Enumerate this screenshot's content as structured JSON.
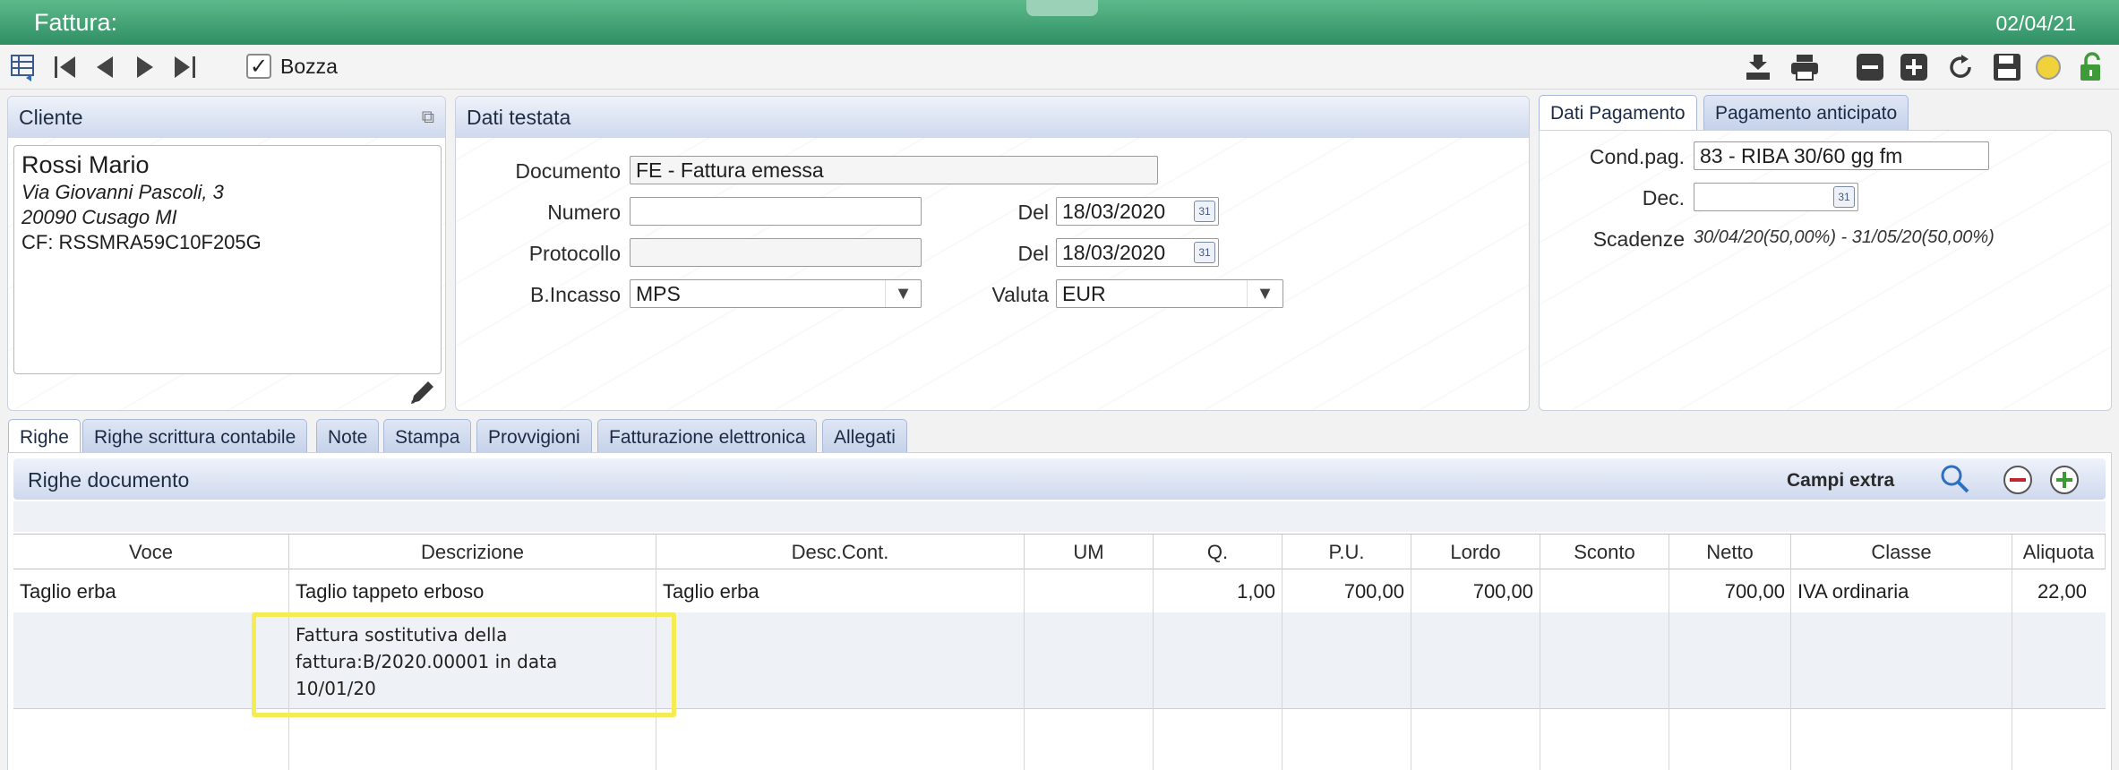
{
  "window": {
    "title": "Fattura:",
    "date": "02/04/21"
  },
  "toolbar": {
    "draft_label": "Bozza",
    "draft_checked": true
  },
  "cliente": {
    "header": "Cliente",
    "name": "Rossi Mario",
    "address1": "Via Giovanni Pascoli, 3",
    "address2": "20090 Cusago  MI",
    "cf": "CF: RSSMRA59C10F205G"
  },
  "testata": {
    "header": "Dati testata",
    "documento_label": "Documento",
    "documento_value": "FE - Fattura emessa",
    "numero_label": "Numero",
    "numero_value": "",
    "del_label": "Del",
    "numero_del_value": "18/03/2020",
    "protocollo_label": "Protocollo",
    "protocollo_value": "",
    "protocollo_del_value": "18/03/2020",
    "incasso_label": "B.Incasso",
    "incasso_value": "MPS",
    "valuta_label": "Valuta",
    "valuta_value": "EUR"
  },
  "pagamento": {
    "tab_dati": "Dati Pagamento",
    "tab_anticipato": "Pagamento anticipato",
    "cond_label": "Cond.pag.",
    "cond_value": "83 - RIBA 30/60 gg fm",
    "dec_label": "Dec.",
    "dec_value": "",
    "scadenze_label": "Scadenze",
    "scadenze_value": "30/04/20(50,00%) - 31/05/20(50,00%)"
  },
  "tabs": [
    "Righe",
    "Righe scrittura contabile",
    "Note",
    "Stampa",
    "Provvigioni",
    "Fatturazione elettronica",
    "Allegati"
  ],
  "righe": {
    "header": "Righe documento",
    "campi_extra": "Campi extra",
    "columns": [
      "Voce",
      "Descrizione",
      "Desc.Cont.",
      "UM",
      "Q.",
      "P.U.",
      "Lordo",
      "Sconto",
      "Netto",
      "Classe",
      "Aliquota"
    ],
    "rows": [
      {
        "voce": "Taglio erba",
        "descrizione": "Taglio tappeto erboso",
        "desc_cont": "Taglio erba",
        "um": "",
        "q": "1,00",
        "pu": "700,00",
        "lordo": "700,00",
        "sconto": "",
        "netto": "700,00",
        "classe": "IVA ordinaria",
        "aliquota": "22,00"
      }
    ],
    "note_lines": [
      "Fattura sostitutiva della",
      "fattura:B/2020.00001 in data",
      "10/01/20"
    ]
  },
  "colors": {
    "titlebar": "#3fa274",
    "panel_header": "#cfd9ee",
    "highlight": "#f4ec52"
  }
}
